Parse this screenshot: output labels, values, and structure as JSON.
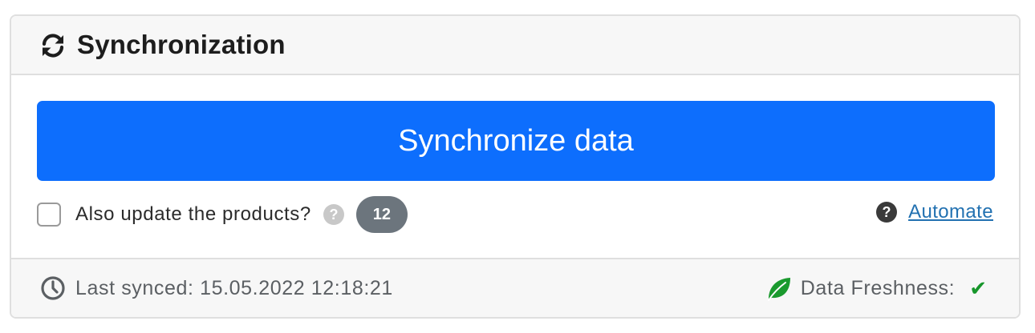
{
  "header": {
    "title": "Synchronization",
    "icon": "sync-icon"
  },
  "body": {
    "sync_button_label": "Synchronize data",
    "update_products": {
      "label": "Also update the products?",
      "checked": false,
      "help_icon": "question-circle-icon",
      "badge_count": "12"
    },
    "automate": {
      "help_icon": "question-circle-icon",
      "link_label": "Automate"
    }
  },
  "footer": {
    "last_synced_label": "Last synced: 15.05.2022 12:18:21",
    "clock_icon": "clock-icon",
    "freshness_label": "Data Freshness:",
    "freshness_icon": "leaf-icon",
    "freshness_status": "✔"
  },
  "colors": {
    "primary": "#0d6efd",
    "badge": "#6c757d",
    "link": "#2271b1",
    "leaf": "#1a9a2e",
    "check": "#17962b"
  }
}
